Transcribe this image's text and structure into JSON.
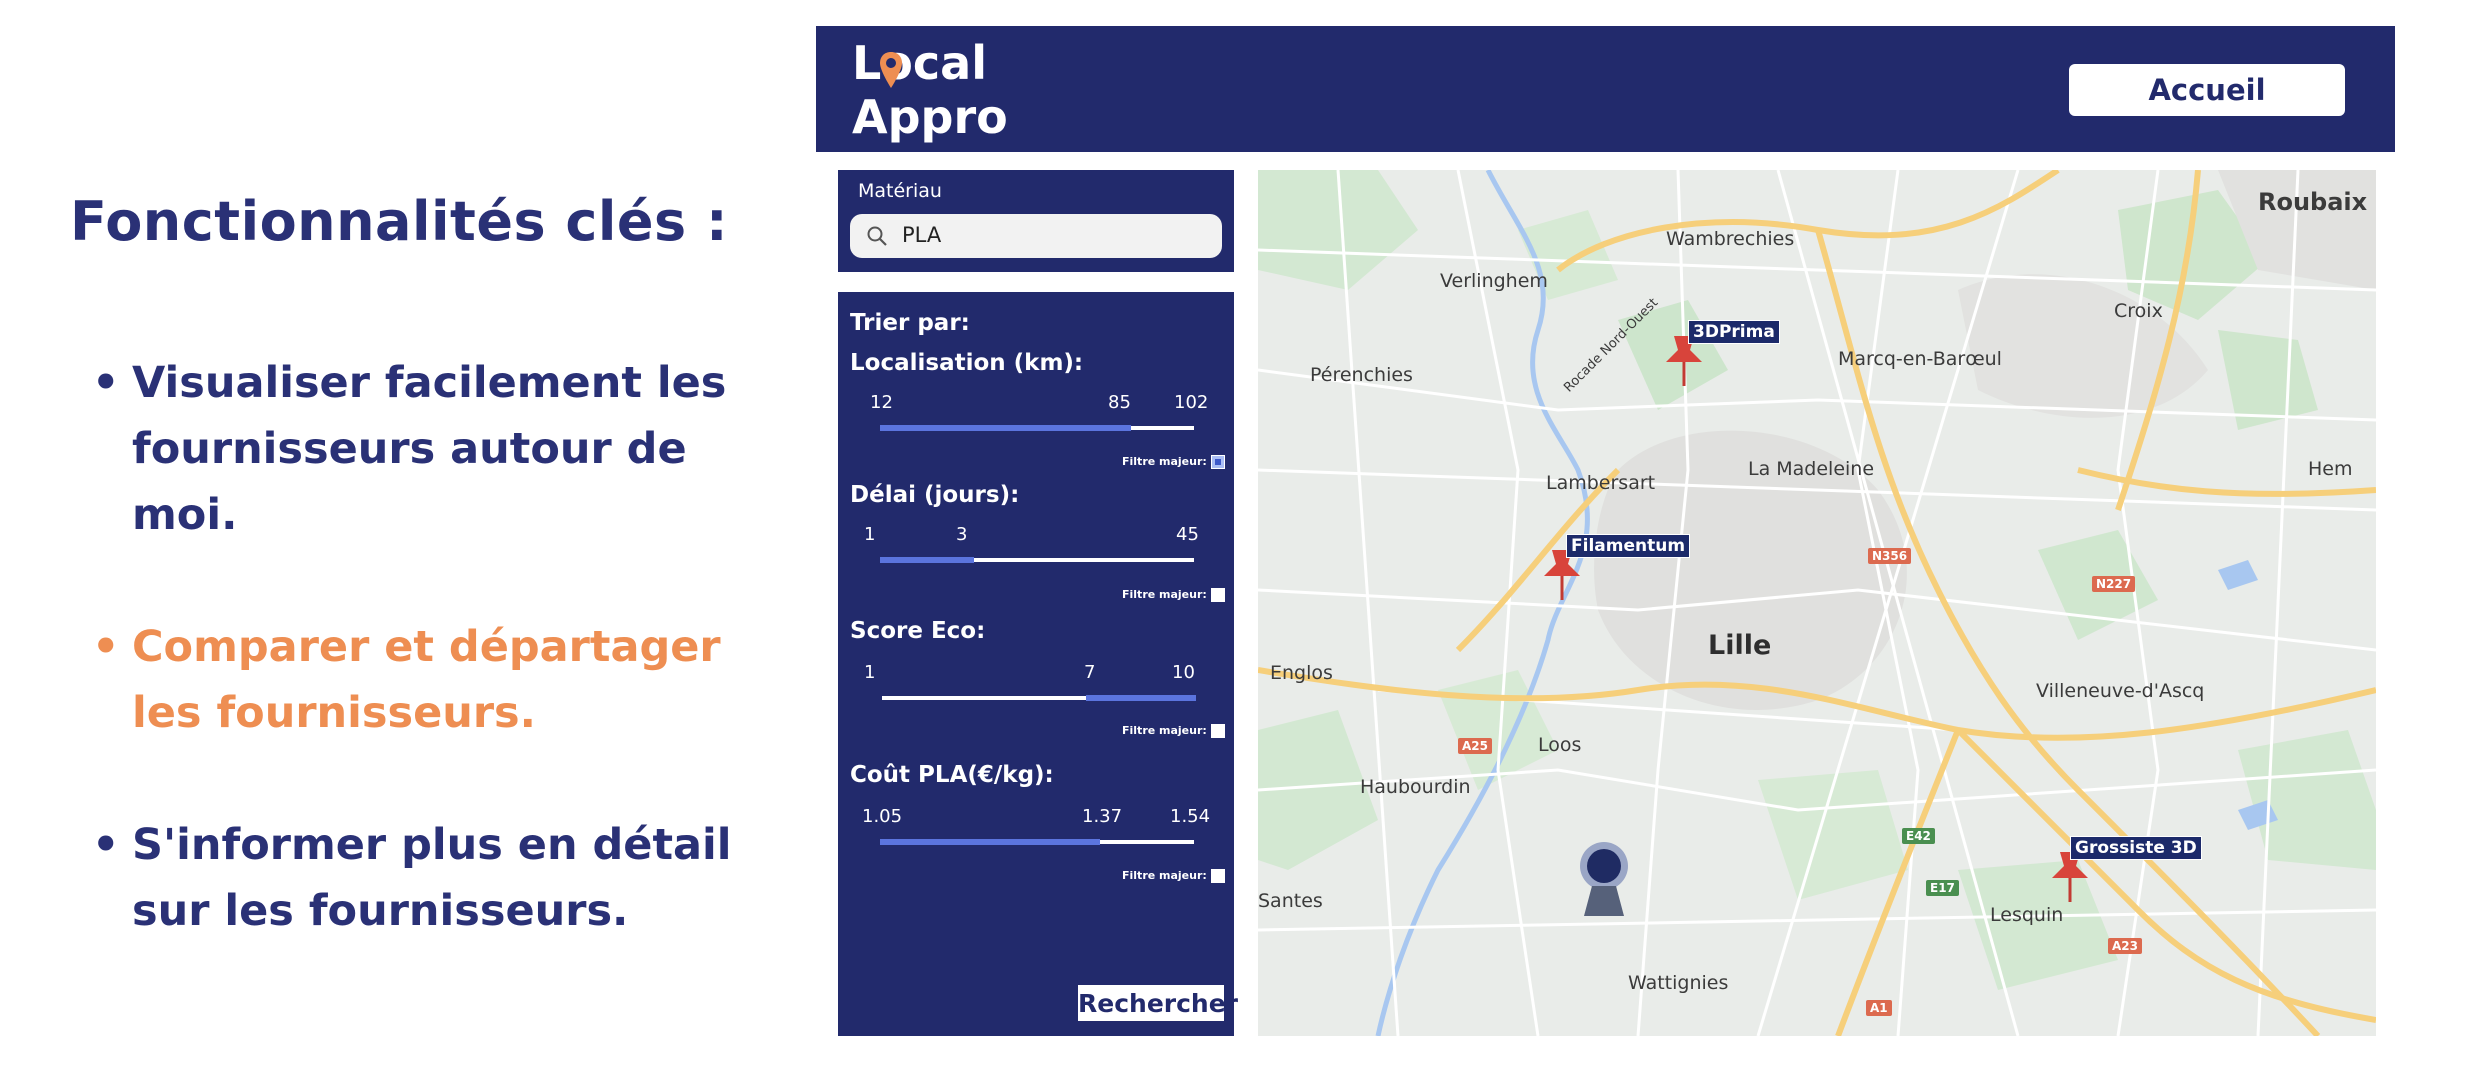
{
  "slide": {
    "heading": "Fonctionnalités clés :",
    "features": [
      "Visualiser facilement les fournisseurs autour de moi.",
      "Comparer et départager les fournisseurs.",
      "S'informer plus en détail sur les fournisseurs."
    ],
    "bullet": "•",
    "colors": {
      "primary": "#2a3176",
      "accent": "#ee8e52"
    }
  },
  "app": {
    "logo_line1": "Local",
    "logo_line2": "Appro",
    "home_button": "Accueil",
    "material": {
      "label": "Matériau",
      "value": "PLA"
    },
    "sort_by": "Trier par:",
    "filter_label": "Filtre majeur:",
    "filters": [
      {
        "title": "Localisation (km):",
        "min": "12",
        "value": "85",
        "max": "102",
        "level": 0.8,
        "major": true
      },
      {
        "title": "Délai (jours):",
        "min": "1",
        "value": "3",
        "max": "45",
        "level": 0.3,
        "major": false
      },
      {
        "title": "Score Eco:",
        "min": "1",
        "value": "7",
        "max": "10",
        "level": 0.65,
        "major": false
      },
      {
        "title": "Coût PLA(€/kg):",
        "min": "1.05",
        "value": "1.37",
        "max": "1.54",
        "level": 0.7,
        "major": false
      }
    ],
    "search_button": "Rechercher"
  },
  "map": {
    "places": {
      "roubaix": "Roubaix",
      "wambrechies": "Wambrechies",
      "verlinghem": "Verlinghem",
      "perenchies": "Pérenchies",
      "rocade": "Rocade Nord-Ouest",
      "croix": "Croix",
      "marcq": "Marcq-en-Barœul",
      "lambersart": "Lambersart",
      "lamadeleine": "La Madeleine",
      "hem": "Hem",
      "lille": "Lille",
      "englos": "Englos",
      "villeneuve": "Villeneuve-d'Ascq",
      "loos": "Loos",
      "haubourdin": "Haubourdin",
      "santes": "Santes",
      "lesquin": "Lesquin",
      "wattignies": "Wattignies"
    },
    "roads": {
      "n356": "N356",
      "n227": "N227",
      "a25": "A25",
      "e42": "E42",
      "e17": "E17",
      "a23": "A23",
      "a1": "A1"
    },
    "suppliers": [
      "3DPrima",
      "Filamentum",
      "Grossiste 3D"
    ]
  }
}
